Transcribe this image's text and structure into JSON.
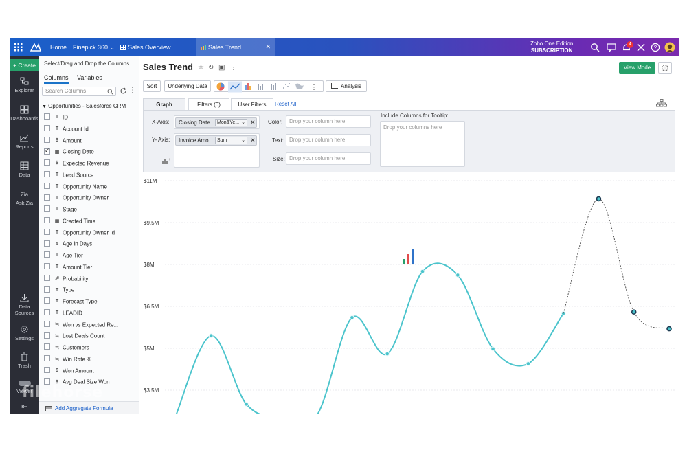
{
  "topbar": {
    "home": "Home",
    "workspace": "Finepick 360",
    "tabs": [
      {
        "label": "Sales Overview"
      },
      {
        "label": "Sales Trend"
      }
    ],
    "edition_line1": "Zoho One Edition",
    "edition_line2": "SUBSCRIPTION",
    "notification_count": "4",
    "colors": {
      "gradient_start": "#1a5fc9",
      "gradient_end": "#7b2aae"
    }
  },
  "leftnav": {
    "create": "Create",
    "items": [
      {
        "label": "Explorer",
        "icon": "explorer-icon"
      },
      {
        "label": "Dashboards",
        "icon": "dashboards-icon"
      },
      {
        "label": "Reports",
        "icon": "reports-icon"
      },
      {
        "label": "Data",
        "icon": "data-icon"
      },
      {
        "label": "Ask Zia",
        "icon": "zia-icon"
      },
      {
        "label_line1": "Data",
        "label_line2": "Sources",
        "icon": "data-sources-icon"
      },
      {
        "label": "Settings",
        "icon": "settings-icon"
      },
      {
        "label": "Trash",
        "icon": "trash-icon"
      },
      {
        "label": "Viewer",
        "icon": "viewer-icon"
      }
    ]
  },
  "columns_panel": {
    "hint": "Select/Drag and Drop the Columns",
    "tabs": [
      "Columns",
      "Variables"
    ],
    "search_placeholder": "Search Columns",
    "source": "Opportunities - Salesforce CRM",
    "columns": [
      {
        "name": "ID",
        "type": "T",
        "checked": false
      },
      {
        "name": "Account Id",
        "type": "T",
        "checked": false
      },
      {
        "name": "Amount",
        "type": "$",
        "checked": false
      },
      {
        "name": "Closing Date",
        "type": "▦",
        "checked": true
      },
      {
        "name": "Expected Revenue",
        "type": "$",
        "checked": false
      },
      {
        "name": "Lead Source",
        "type": "T",
        "checked": false
      },
      {
        "name": "Opportunity Name",
        "type": "T",
        "checked": false
      },
      {
        "name": "Opportunity Owner",
        "type": "T",
        "checked": false
      },
      {
        "name": "Stage",
        "type": "T",
        "checked": false
      },
      {
        "name": "Created Time",
        "type": "▦",
        "checked": false
      },
      {
        "name": "Opportunity Owner Id",
        "type": "T",
        "checked": false
      },
      {
        "name": "Age in Days",
        "type": "#",
        "checked": false
      },
      {
        "name": "Age Tier",
        "type": "T",
        "checked": false
      },
      {
        "name": "Amount Tier",
        "type": "T",
        "checked": false
      },
      {
        "name": "Probability",
        "type": ".#",
        "checked": false
      },
      {
        "name": "Type",
        "type": "T",
        "checked": false
      },
      {
        "name": "Forecast Type",
        "type": "T",
        "checked": false
      },
      {
        "name": "LEADID",
        "type": "T",
        "checked": false
      },
      {
        "name": "Won vs Expected Re...",
        "type": "≒",
        "checked": false
      },
      {
        "name": "Lost Deals Count",
        "type": "≒",
        "checked": false
      },
      {
        "name": "Customers",
        "type": "≒",
        "checked": false
      },
      {
        "name": "Win Rate %",
        "type": "≒",
        "checked": false
      },
      {
        "name": "Won Amount",
        "type": "$",
        "checked": false
      },
      {
        "name": "Avg Deal Size Won",
        "type": "$",
        "checked": false
      }
    ],
    "footer_link": "Add Aggregate Formula"
  },
  "main": {
    "title": "Sales Trend",
    "view_mode": "View Mode",
    "toolbar": {
      "sort": "Sort",
      "underlying": "Underlying Data",
      "analysis": "Analysis"
    },
    "cfg_tabs": [
      "Graph",
      "Filters (0)",
      "User Filters"
    ],
    "reset_all": "Reset All",
    "x_axis": {
      "label": "X-Axis:",
      "column": "Closing Date",
      "fn": "Mon&Ye..."
    },
    "y_axis": {
      "label": "Y- Axis:",
      "column": "Invoice Amo...",
      "fn": "Sum"
    },
    "color": {
      "label": "Color:",
      "placeholder": "Drop your column here"
    },
    "text": {
      "label": "Text:",
      "placeholder": "Drop your column here"
    },
    "size": {
      "label": "Size:",
      "placeholder": "Drop your column here"
    },
    "tooltip": {
      "label": "Include Columns for Tooltip:",
      "placeholder": "Drop your columns here"
    }
  },
  "chart_data": {
    "type": "line",
    "title": "",
    "xlabel": "",
    "ylabel": "",
    "y_ticks": [
      "$11M",
      "$9.5M",
      "$8M",
      "$6.5M",
      "$5M",
      "$3.5M"
    ],
    "y_tick_values": [
      11,
      9.5,
      8,
      6.5,
      5,
      3.5
    ],
    "ylim": [
      2.5,
      11
    ],
    "grid": true,
    "series": [
      {
        "color": "#4bc4cc",
        "style": "solid",
        "values": [
          2.6,
          5.45,
          3.0,
          2.5,
          2.6,
          6.1,
          4.8,
          7.75,
          7.62,
          4.98,
          4.45,
          6.25
        ]
      },
      {
        "color": "#555555",
        "style": "dotted",
        "values_from_index": 11,
        "values": [
          6.25,
          10.35,
          6.3,
          5.7
        ]
      }
    ],
    "x_index": [
      0,
      1,
      2,
      3,
      4,
      5,
      6,
      7,
      8,
      9,
      10,
      11,
      12,
      13,
      14
    ]
  }
}
